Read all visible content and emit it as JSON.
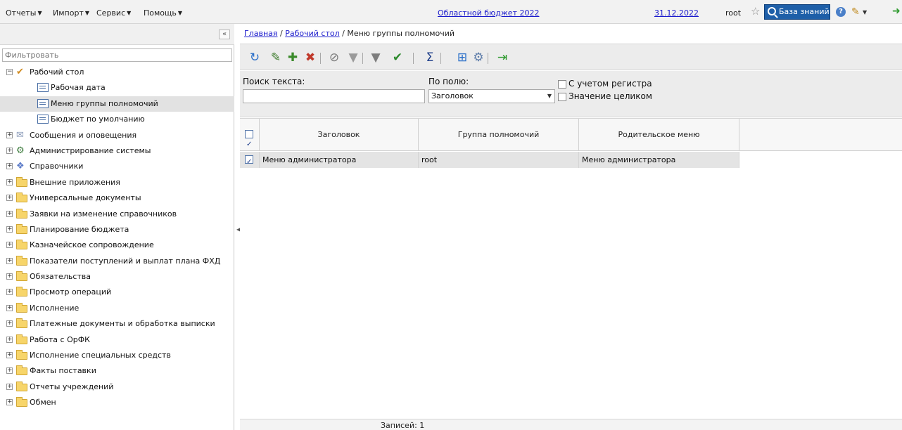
{
  "topbar": {
    "menus": [
      {
        "label": "Отчеты"
      },
      {
        "label": "Импорт"
      },
      {
        "label": "Сервис"
      },
      {
        "label": "Помощь"
      }
    ],
    "budget_link": "Областной бюджет 2022",
    "date_link": "31.12.2022",
    "user": "root",
    "knowledge_base": "База знаний",
    "help_glyph": "?"
  },
  "left": {
    "collapse_glyph": "«",
    "filter_placeholder": "Фильтровать",
    "tree": [
      {
        "label": "Рабочий стол",
        "level": 0,
        "icon": "desktop-icon",
        "expanded": true
      },
      {
        "label": "Рабочая дата",
        "level": 1,
        "icon": "leaf-icon"
      },
      {
        "label": "Меню группы полномочий",
        "level": 1,
        "icon": "leaf-icon",
        "selected": true
      },
      {
        "label": "Бюджет по умолчанию",
        "level": 1,
        "icon": "leaf-icon"
      },
      {
        "label": "Сообщения и оповещения",
        "level": 0,
        "icon": "envelope-icon"
      },
      {
        "label": "Администрирование системы",
        "level": 0,
        "icon": "admin-icon"
      },
      {
        "label": "Справочники",
        "level": 0,
        "icon": "reference-icon"
      },
      {
        "label": "Внешние приложения",
        "level": 0,
        "icon": "folder-icon"
      },
      {
        "label": "Универсальные документы",
        "level": 0,
        "icon": "folder-icon"
      },
      {
        "label": "Заявки на изменение справочников",
        "level": 0,
        "icon": "folder-icon"
      },
      {
        "label": "Планирование бюджета",
        "level": 0,
        "icon": "folder-icon"
      },
      {
        "label": "Казначейское сопровождение",
        "level": 0,
        "icon": "folder-icon"
      },
      {
        "label": "Показатели поступлений и выплат плана ФХД",
        "level": 0,
        "icon": "folder-icon"
      },
      {
        "label": "Обязательства",
        "level": 0,
        "icon": "folder-icon"
      },
      {
        "label": "Просмотр операций",
        "level": 0,
        "icon": "folder-icon"
      },
      {
        "label": "Исполнение",
        "level": 0,
        "icon": "folder-icon"
      },
      {
        "label": "Платежные документы и обработка выписки",
        "level": 0,
        "icon": "folder-icon"
      },
      {
        "label": "Работа с ОрФК",
        "level": 0,
        "icon": "folder-icon"
      },
      {
        "label": "Исполнение специальных средств",
        "level": 0,
        "icon": "folder-icon"
      },
      {
        "label": "Факты поставки",
        "level": 0,
        "icon": "folder-icon"
      },
      {
        "label": "Отчеты учреждений",
        "level": 0,
        "icon": "folder-icon"
      },
      {
        "label": "Обмен",
        "level": 0,
        "icon": "folder-icon"
      }
    ]
  },
  "main": {
    "breadcrumb": {
      "home": "Главная",
      "sep1": " / ",
      "desktop": "Рабочий стол",
      "sep2": " / ",
      "current": "Меню группы полномочий"
    },
    "toolbar": [
      {
        "name": "refresh-icon",
        "glyph": "↻",
        "color": "#2a6fc9"
      },
      {
        "name": "edit-icon",
        "glyph": "✎",
        "color": "#3b7a2a"
      },
      {
        "name": "add-icon",
        "glyph": "✚",
        "color": "#3a8a2a"
      },
      {
        "name": "delete-icon",
        "glyph": "✖",
        "color": "#c0392b"
      },
      {
        "name": "clear-filter-icon",
        "glyph": "⊘",
        "color": "#7a7a7a"
      },
      {
        "name": "filter-icon",
        "glyph": "▼",
        "color": "#9a9a9a"
      },
      {
        "name": "filter-settings-icon",
        "glyph": "▼",
        "color": "#7d7d7d"
      },
      {
        "name": "check-menu-icon",
        "glyph": "✔",
        "color": "#2e8b2e"
      },
      {
        "name": "sum-icon",
        "glyph": "Σ",
        "color": "#1f3f8a"
      },
      {
        "name": "export-icon",
        "glyph": "⊞",
        "color": "#2a6fc9"
      },
      {
        "name": "settings-icon",
        "glyph": "⚙",
        "color": "#5a7aa8"
      },
      {
        "name": "exit-icon",
        "glyph": "⇥",
        "color": "#2e9a2e"
      }
    ],
    "search": {
      "text_label": "Поиск текста:",
      "text_value": "",
      "field_label": "По полю:",
      "field_value": "Заголовок",
      "case_label": "С учетом регистра",
      "whole_label": "Значение целиком"
    },
    "grid": {
      "columns": [
        "Заголовок",
        "Группа полномочий",
        "Родительское меню"
      ],
      "rows": [
        {
          "title": "Меню администратора",
          "group": "root",
          "parent": "Меню администратора",
          "checked": true
        }
      ],
      "records": "Записей: 1"
    }
  }
}
